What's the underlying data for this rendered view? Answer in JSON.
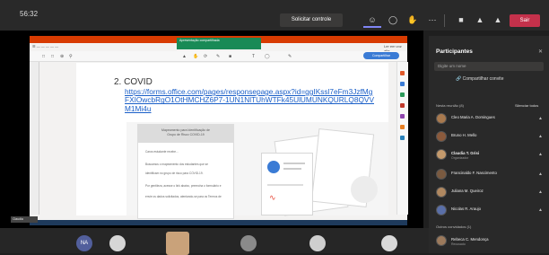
{
  "meeting": {
    "timer": "56:32",
    "request_control_label": "Solicitar controle",
    "leave_label": "Sair"
  },
  "shared_app": {
    "heading": "2. COVID",
    "link": "https://forms.office.com/pages/responsepage.aspx?id=ggIKssl7eFm3JzfMgFXIOwcbRgO1OtHMCHZ6P7-1UN1NlTUhWTFk45UlUMUNKQURLQ8QVVM1Mi4u",
    "doc_header_line1": "Mapeamento para Identificação de",
    "doc_header_line2": "Grupo de Risco COVID-19",
    "doc_lines": [
      "Caros estudante recebe...",
      "Buscamos o mapeamento dos estudantes que se",
      "identificam no grupo de risco para COVID-19.",
      "Por gentileza, acesse o link abaixo, preencha o formulário e",
      "envie os dados solicitados, atentando-se para os Termos de"
    ],
    "notify_text": "Apresentação compartilhada",
    "share_pill_label": "Compartilhar",
    "tools_right": "Ler em voz alta"
  },
  "presenter_tag": "Claudia",
  "participants_panel": {
    "title": "Participantes",
    "search_placeholder": "Digite um nome",
    "share_invite_label": "Compartilhar convite",
    "in_meeting_label": "Nesta reunião (8)",
    "mute_all_label": "Silenciar todos",
    "others_label": "Outros convidados (1)",
    "people": [
      {
        "name": "Cleo Maria A. Domingues",
        "role": ""
      },
      {
        "name": "Bruno H. Mello",
        "role": ""
      },
      {
        "name": "Claudia T. Grisi",
        "role": "Organizador"
      },
      {
        "name": "Francinaldo F. Nascimento",
        "role": ""
      },
      {
        "name": "Juliana M. Queiroz",
        "role": ""
      },
      {
        "name": "Nicolas R. Araujo",
        "role": ""
      }
    ],
    "other_person": {
      "name": "Rebeca C. Mendonça",
      "role": "Recusado"
    }
  },
  "video_strip": {
    "initials": "NA"
  }
}
